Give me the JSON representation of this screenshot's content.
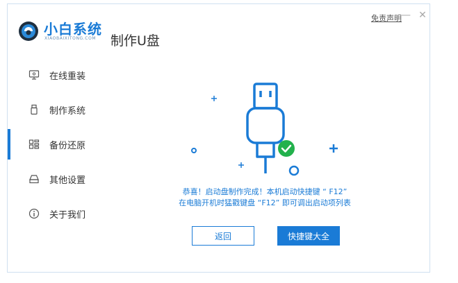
{
  "app": {
    "name": "小白系统",
    "domain": "XIAOBAIXITONG.COM",
    "page_title": "制作U盘"
  },
  "titlebar": {
    "disclaimer": "免责声明",
    "minimize": "—",
    "close": "✕"
  },
  "sidebar": {
    "items": [
      {
        "label": "在线重装",
        "icon": "monitor-icon",
        "active": false
      },
      {
        "label": "制作系统",
        "icon": "usb-icon",
        "active": false
      },
      {
        "label": "备份还原",
        "icon": "grid-icon",
        "active": true
      },
      {
        "label": "其他设置",
        "icon": "drive-icon",
        "active": false
      },
      {
        "label": "关于我们",
        "icon": "info-icon",
        "active": false
      }
    ]
  },
  "main": {
    "message_line1": "恭喜！启动盘制作完成！本机启动快捷键 “ F12”",
    "message_line2": "在电脑开机时猛戳键盘 “F12” 即可调出启动项列表",
    "back_button": "返回",
    "hotkeys_button": "快捷键大全"
  },
  "colors": {
    "accent": "#1a7bd6",
    "success": "#22b14c"
  }
}
